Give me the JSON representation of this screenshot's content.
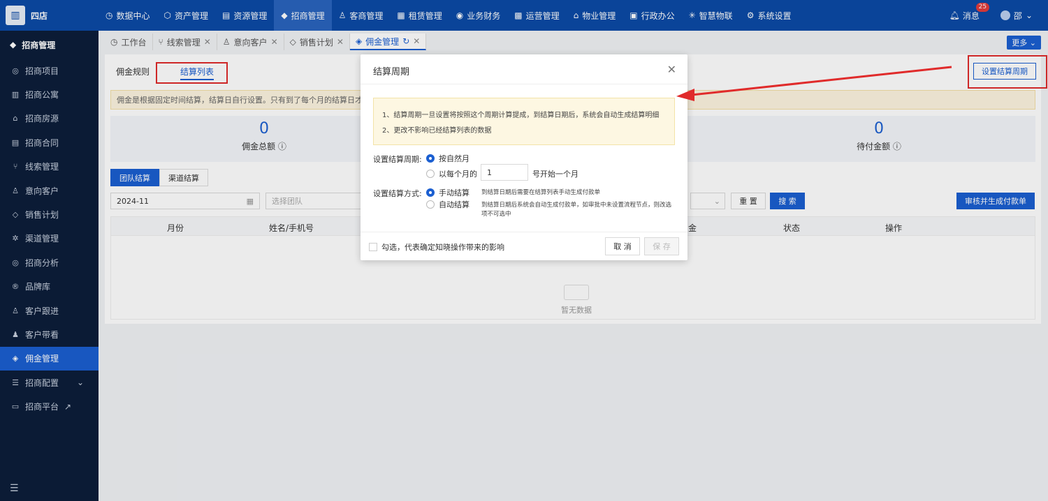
{
  "brand": {
    "logo_icon": "building-icon",
    "name": "四店"
  },
  "topnav": [
    {
      "label": "数据中心",
      "icon": "clock-icon"
    },
    {
      "label": "资产管理",
      "icon": "cube-icon"
    },
    {
      "label": "资源管理",
      "icon": "building-icon"
    },
    {
      "label": "招商管理",
      "icon": "tag-icon",
      "active": true
    },
    {
      "label": "客商管理",
      "icon": "users-icon"
    },
    {
      "label": "租赁管理",
      "icon": "file-icon"
    },
    {
      "label": "业务财务",
      "icon": "dollar-icon"
    },
    {
      "label": "运营管理",
      "icon": "grid-icon"
    },
    {
      "label": "物业管理",
      "icon": "home-icon"
    },
    {
      "label": "行政办公",
      "icon": "briefcase-icon"
    },
    {
      "label": "智慧物联",
      "icon": "sun-icon"
    },
    {
      "label": "系统设置",
      "icon": "gear-icon"
    }
  ],
  "header": {
    "messages_label": "消息",
    "messages_count": "25",
    "user_name": "邵"
  },
  "sidebar": {
    "title": "招商管理",
    "items": [
      {
        "label": "招商项目"
      },
      {
        "label": "招商公寓"
      },
      {
        "label": "招商房源"
      },
      {
        "label": "招商合同"
      },
      {
        "label": "线索管理"
      },
      {
        "label": "意向客户"
      },
      {
        "label": "销售计划"
      },
      {
        "label": "渠道管理"
      },
      {
        "label": "招商分析"
      },
      {
        "label": "品牌库"
      },
      {
        "label": "客户跟进"
      },
      {
        "label": "客户带看"
      },
      {
        "label": "佣金管理",
        "active": true
      },
      {
        "label": "招商配置"
      },
      {
        "label": "招商平台"
      }
    ]
  },
  "tabs": {
    "items": [
      {
        "label": "工作台"
      },
      {
        "label": "线索管理"
      },
      {
        "label": "意向客户"
      },
      {
        "label": "销售计划"
      },
      {
        "label": "佣金管理",
        "active": true
      }
    ],
    "more_label": "更多"
  },
  "page": {
    "subtabs": [
      {
        "label": "佣金规则"
      },
      {
        "label": "结算列表",
        "active": true
      }
    ],
    "set_period_button": "设置结算周期",
    "notice": "佣金是根据固定时间结算，结算日自行设置。只有到了每个月的结算日才会将这段时",
    "stats": [
      {
        "value": "0",
        "label": "佣金总额"
      },
      {
        "value": "0",
        "label": "待付金额"
      }
    ],
    "type_tabs": [
      {
        "label": "团队结算",
        "active": true
      },
      {
        "label": "渠道结算"
      }
    ],
    "filters": {
      "month_value": "2024-11",
      "team_placeholder": "选择团队",
      "reset_label": "重 置",
      "search_label": "搜 索",
      "review_label": "审核并生成付款单"
    },
    "table": {
      "columns": [
        "月份",
        "姓名/手机号",
        "金",
        "状态",
        "操作"
      ],
      "empty_text": "暂无数据"
    }
  },
  "modal": {
    "title": "结算周期",
    "tip_lines": [
      "1、结算周期一旦设置将按照这个周期计算提成，到结算日期后，系统会自动生成结算明细",
      "2、更改不影响已经结算列表的数据"
    ],
    "period_label": "设置结算周期:",
    "period_option1": "按自然月",
    "period_option2_prefix": "以每个月的",
    "period_day_value": "1",
    "period_option2_suffix": "号开始一个月",
    "method_label": "设置结算方式:",
    "method_option1": "手动结算",
    "method_option1_desc": "到结算日期后需要在结算列表手动生成付款单",
    "method_option2": "自动结算",
    "method_option2_desc_line1": "到结算日期后系统会自动生成付款单，如审批中未设置流程节点，则改选",
    "method_option2_desc_line2": "项不可选中",
    "ack_label": "勾选，代表确定知晓操作带来的影响",
    "cancel_label": "取 消",
    "save_label": "保 存"
  },
  "colors": {
    "primary": "#1b5fd1",
    "topbar": "#0b4aa6",
    "sidebar": "#0c1e3a",
    "highlight": "#e02b2b"
  }
}
